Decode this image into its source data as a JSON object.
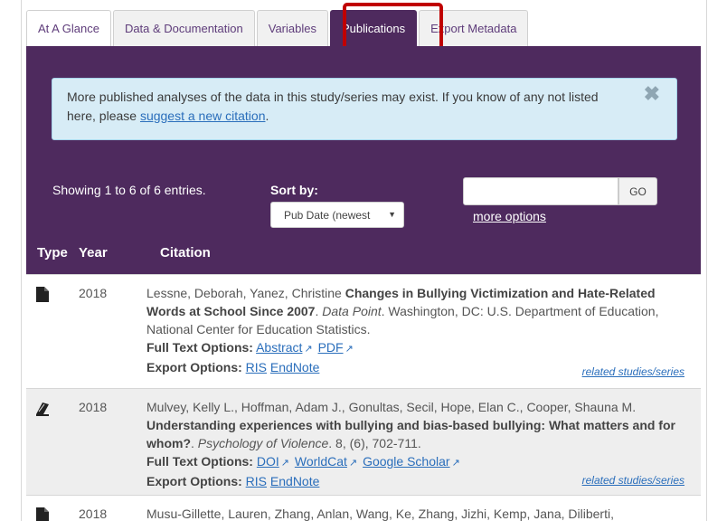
{
  "tabs": [
    {
      "label": "At A Glance"
    },
    {
      "label": "Data & Documentation"
    },
    {
      "label": "Variables"
    },
    {
      "label": "Publications"
    },
    {
      "label": "Export Metadata"
    }
  ],
  "alert": {
    "text": "More published analyses of the data in this study/series may exist. If you know of any not listed here, please ",
    "link": "suggest a new citation",
    "after": ".",
    "close_icon": "✖"
  },
  "controls": {
    "showing": "Showing 1 to 6 of 6 entries.",
    "sort_label": "Sort by:",
    "sort_value": "Pub Date (newest",
    "search_placeholder": "",
    "go": "GO",
    "more_options": "more options"
  },
  "table": {
    "headers": [
      "Type",
      "Year",
      "Citation"
    ],
    "full_text_label": "Full Text Options:",
    "export_label": "Export Options:",
    "related": "related studies/series",
    "rows": [
      {
        "type_icon": "document-icon",
        "year": "2018",
        "authors": "Lessne, Deborah, Yanez, Christine ",
        "title": "Changes in Bullying Victimization and Hate-Related Words at School Since 2007",
        "journal": "Data Point",
        "rest": ". Washington, DC: U.S. Department of Education, National Center for Education Statistics.",
        "fulltext": [
          "Abstract",
          "PDF"
        ],
        "export": [
          "RIS",
          "EndNote"
        ]
      },
      {
        "type_icon": "journal-icon",
        "year": "2018",
        "authors": "Mulvey, Kelly L., Hoffman, Adam J., Gonultas, Secil, Hope, Elan C., Cooper, Shauna M. ",
        "title": "Understanding experiences with bullying and bias-based bullying: What matters and for whom?",
        "journal": "Psychology of Violence",
        "rest": ". 8, (6), 702-711.",
        "fulltext": [
          "DOI",
          "WorldCat",
          "Google Scholar"
        ],
        "export": [
          "RIS",
          "EndNote"
        ]
      },
      {
        "type_icon": "document-icon",
        "year": "2018",
        "authors": "Musu-Gillette, Lauren, Zhang, Anlan, Wang, Ke, Zhang, Jizhi, Kemp, Jana, Diliberti,"
      }
    ]
  },
  "colors": {
    "panel": "#4e2a5e",
    "link": "#2a6ebb",
    "highlight": "#c00000"
  }
}
